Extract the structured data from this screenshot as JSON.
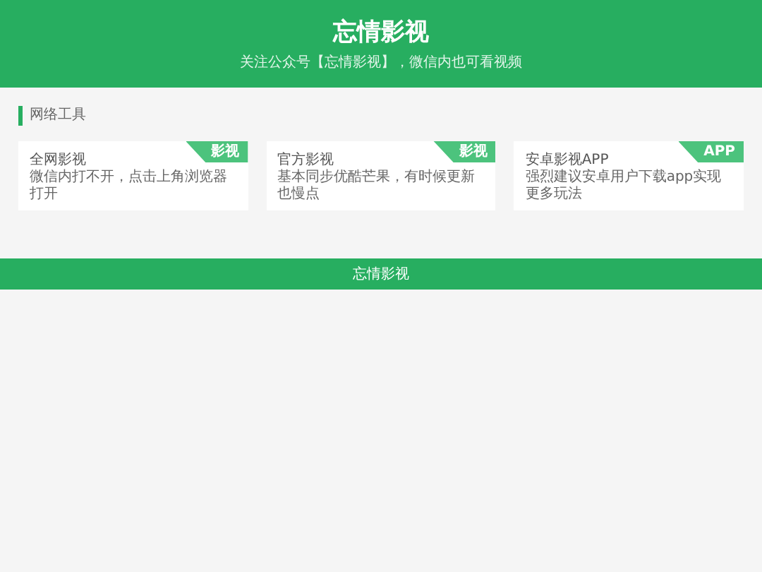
{
  "header": {
    "title": "忘情影视",
    "subtitle": "关注公众号【忘情影视】，微信内也可看视频"
  },
  "section": {
    "title": "网络工具"
  },
  "cards": [
    {
      "title": "全网影视",
      "description": "微信内打不开，点击上角浏览器打开",
      "badge": "影视"
    },
    {
      "title": "官方影视",
      "description": "基本同步优酷芒果，有时候更新也慢点",
      "badge": "影视"
    },
    {
      "title": "安卓影视APP",
      "description": "强烈建议安卓用户下载app实现更多玩法",
      "badge": "APP"
    }
  ],
  "footer": {
    "text": "忘情影视"
  }
}
